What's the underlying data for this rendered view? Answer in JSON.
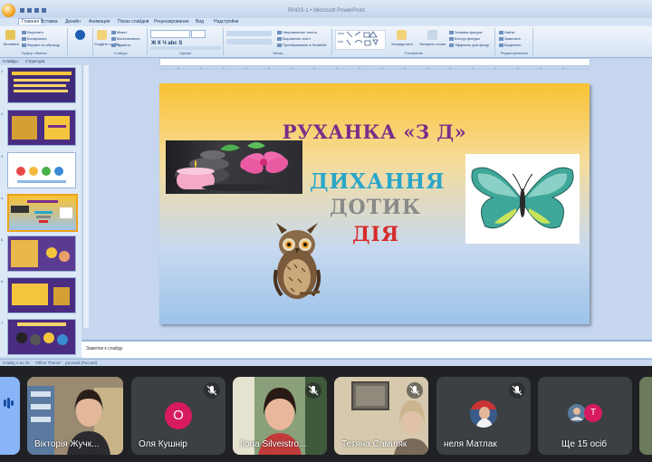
{
  "window": {
    "title": "RHOS-1 • Microsoft PowerPoint"
  },
  "ribbon": {
    "tabs": [
      "Главная",
      "Вставка",
      "Дизайн",
      "Анимация",
      "Показ слайдов",
      "Рецензирование",
      "Вид",
      "Надстройки"
    ],
    "groups": [
      "Буфер обмена",
      "Слайды",
      "Шрифт",
      "Абзац",
      "Рисование",
      "Редактирование"
    ],
    "clipboard": {
      "paste": "Вставить",
      "cut": "Вырезать",
      "copy": "Копировать",
      "format": "Формат по образцу"
    },
    "slides": {
      "create": "Создать слайд",
      "layout": "Макет",
      "restore": "Восстановить",
      "delete": "Удалить"
    },
    "paragraph": {
      "direction": "Направление текста",
      "align": "Выровнять текст",
      "smartart": "Преобразовать в SmartArt"
    },
    "drawing": {
      "arrange": "Упорядочить",
      "styles": "Экспресс-стили",
      "fill": "Заливка фигуры",
      "outline": "Контур фигуры",
      "effects": "Эффекты для фигур"
    },
    "editing": {
      "find": "Найти",
      "replace": "Заменить",
      "select": "Выделить"
    }
  },
  "slides_panel": {
    "tab_slides": "Слайды",
    "tab_structure": "Структура",
    "count": 8,
    "active_index": 4
  },
  "slide": {
    "title": "РУХАНКА «З Д»",
    "word1": "ДИХАННЯ",
    "word2": "ДОТИК",
    "word3": "ДІЯ"
  },
  "notes_placeholder": "Заметки к слайду",
  "status": {
    "slide": "Слайд 4 из 20",
    "theme": "\"Office Theme\"",
    "lang": "русский (Россия)"
  },
  "meet": {
    "participants": [
      {
        "name": "Вікторія Жучк...",
        "muted": false,
        "has_video": true
      },
      {
        "name": "Оля Кушнір",
        "muted": true,
        "initial": "О",
        "avatar_color": "#d81b60",
        "has_video": false
      },
      {
        "name": "Ilona Silveistro...",
        "muted": true,
        "has_video": true
      },
      {
        "name": "Тетяна Саміляк",
        "muted": true,
        "has_video": true
      },
      {
        "name": "неля Матлак",
        "muted": true,
        "has_video": false
      },
      {
        "name": "Ще 15 осіб",
        "muted": false,
        "initial": "Т",
        "avatar_color": "#d81b60",
        "has_video": false
      }
    ]
  }
}
